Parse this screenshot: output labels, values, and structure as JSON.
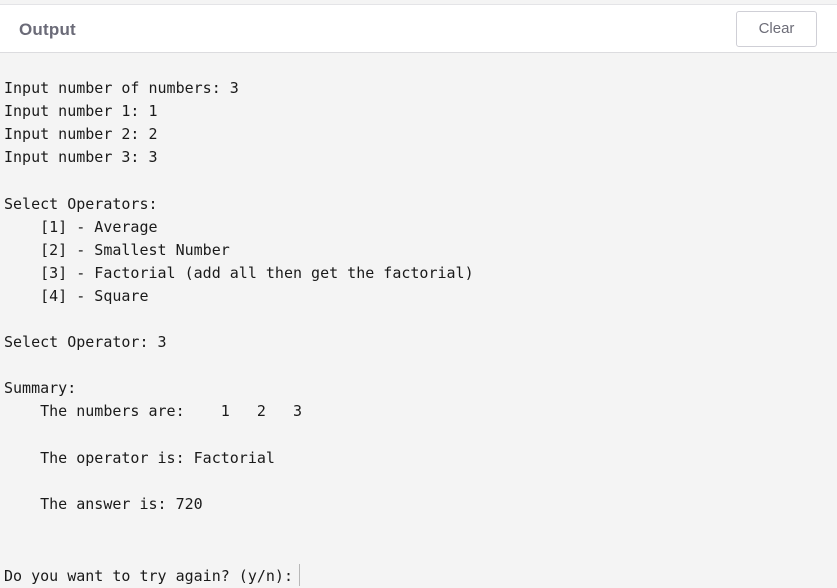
{
  "header": {
    "title": "Output",
    "clear_label": "Clear"
  },
  "terminal": {
    "lines": [
      "Input number of numbers: 3",
      "Input number 1: 1",
      "Input number 2: 2",
      "Input number 3: 3",
      "Select Operators:",
      "    [1] - Average",
      "    [2] - Smallest Number",
      "    [3] - Factorial (add all then get the factorial)",
      "    [4] - Square",
      "Select Operator: 3",
      "Summary:",
      "    The numbers are:    1   2   3",
      "    The operator is: Factorial",
      "    The answer is: 720",
      "Do you want to try again? (y/n):"
    ]
  }
}
